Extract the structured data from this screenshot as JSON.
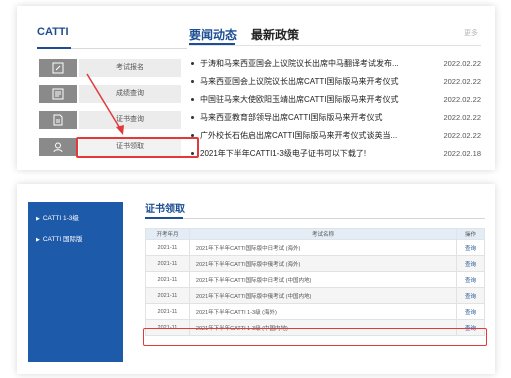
{
  "top": {
    "catti_title": "CATTI",
    "sidebar": [
      {
        "label": "考试报名",
        "icon": "edit-icon"
      },
      {
        "label": "成绩查询",
        "icon": "list-icon"
      },
      {
        "label": "证书查询",
        "icon": "document-icon"
      },
      {
        "label": "证书领取",
        "icon": "user-icon"
      }
    ],
    "tabs": {
      "news": "要闻动态",
      "policy": "最新政策"
    },
    "more": "更多",
    "news": [
      {
        "title": "于涛和马来西亚国会上议院议长出席中马翻译考试发布...",
        "date": "2022.02.22"
      },
      {
        "title": "马来西亚国会上议院议长出席CATTI国际版马来开考仪式",
        "date": "2022.02.22"
      },
      {
        "title": "中国驻马来大使欧阳玉靖出席CATTI国际版马来开考仪式",
        "date": "2022.02.22"
      },
      {
        "title": "马来西亚教育部领导出席CATTI国际版马来开考仪式",
        "date": "2022.02.22"
      },
      {
        "title": "广外校长石佑启出席CATTI国际版马来开考仪式谈英当...",
        "date": "2022.02.22"
      },
      {
        "title": "2021年下半年CATTI1-3级电子证书可以下载了!",
        "date": "2022.02.18"
      }
    ]
  },
  "bottom": {
    "sidebar": [
      "CATTI 1-3级",
      "CATTI 国际版"
    ],
    "section_title": "证书领取",
    "table": {
      "headers": [
        "开考年月",
        "考试名称",
        "操作"
      ],
      "rows": [
        {
          "date": "2021-11",
          "name": "2021年下半年CATTI国际版中日考试 (海外)",
          "action": "查询"
        },
        {
          "date": "2021-11",
          "name": "2021年下半年CATTI国际版中俄考试 (海外)",
          "action": "查询"
        },
        {
          "date": "2021-11",
          "name": "2021年下半年CATTI国际版中日考试 (中国内地)",
          "action": "查询"
        },
        {
          "date": "2021-11",
          "name": "2021年下半年CATTI国际版中俄考试 (中国内地)",
          "action": "查询"
        },
        {
          "date": "2021-11",
          "name": "2021年下半年CATTI 1-3级 (海外)",
          "action": "查询"
        },
        {
          "date": "2021-11",
          "name": "2021年下半年CATTI 1-3级 (中国内地)",
          "action": "查询"
        }
      ]
    }
  },
  "colors": {
    "brand_blue": "#1d4d94",
    "sidebar_blue": "#1e5aaa",
    "highlight_red": "#e23a3a"
  }
}
